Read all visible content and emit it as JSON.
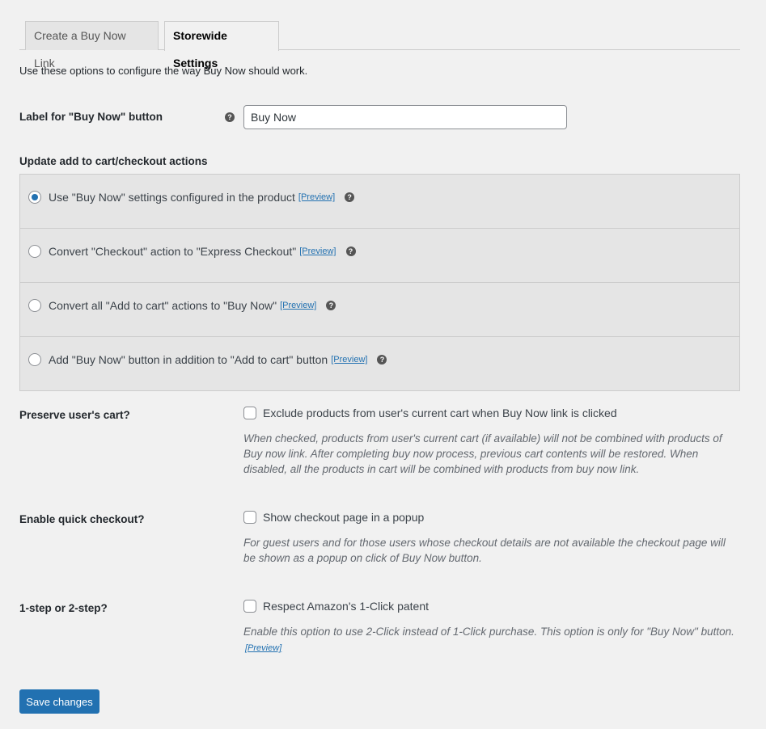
{
  "tabs": [
    {
      "label": "Create a Buy Now Link",
      "active": false
    },
    {
      "label": "Storewide Settings",
      "active": true
    }
  ],
  "intro": "Use these options to configure the way Buy Now should work.",
  "buy_now_label": {
    "label": "Label for \"Buy Now\" button",
    "help_icon": "?",
    "value": "Buy Now"
  },
  "actions": {
    "heading": "Update add to cart/checkout actions",
    "options": [
      {
        "label": "Use \"Buy Now\" settings configured in the product",
        "preview": "[Preview]",
        "checked": true
      },
      {
        "label": "Convert \"Checkout\" action to \"Express Checkout\"",
        "preview": "[Preview]",
        "checked": false
      },
      {
        "label": "Convert all \"Add to cart\" actions to \"Buy Now\"",
        "preview": "[Preview]",
        "checked": false
      },
      {
        "label": "Add \"Buy Now\" button in addition to \"Add to cart\" button",
        "preview": "[Preview]",
        "checked": false
      }
    ]
  },
  "preserve_cart": {
    "label": "Preserve user's cart?",
    "checkbox_label": "Exclude products from user's current cart when Buy Now link is clicked",
    "checked": false,
    "description": "When checked, products from user's current cart (if available) will not be combined with products of Buy now link. After completing buy now process, previous cart contents will be restored. When disabled, all the products in cart will be combined with products from buy now link."
  },
  "quick_checkout": {
    "label": "Enable quick checkout?",
    "checkbox_label": "Show checkout page in a popup",
    "checked": false,
    "description": "For guest users and for those users whose checkout details are not available the checkout page will be shown as a popup on click of Buy Now button."
  },
  "step": {
    "label": "1-step or 2-step?",
    "checkbox_label": "Respect Amazon's 1-Click patent",
    "checked": false,
    "description": "Enable this option to use 2-Click instead of 1-Click purchase. This option is only for \"Buy Now\" button.",
    "preview": "[Preview]"
  },
  "save_label": "Save changes",
  "colors": {
    "primary": "#2271b1",
    "background": "#f1f1f1",
    "panel": "#e5e5e5"
  }
}
